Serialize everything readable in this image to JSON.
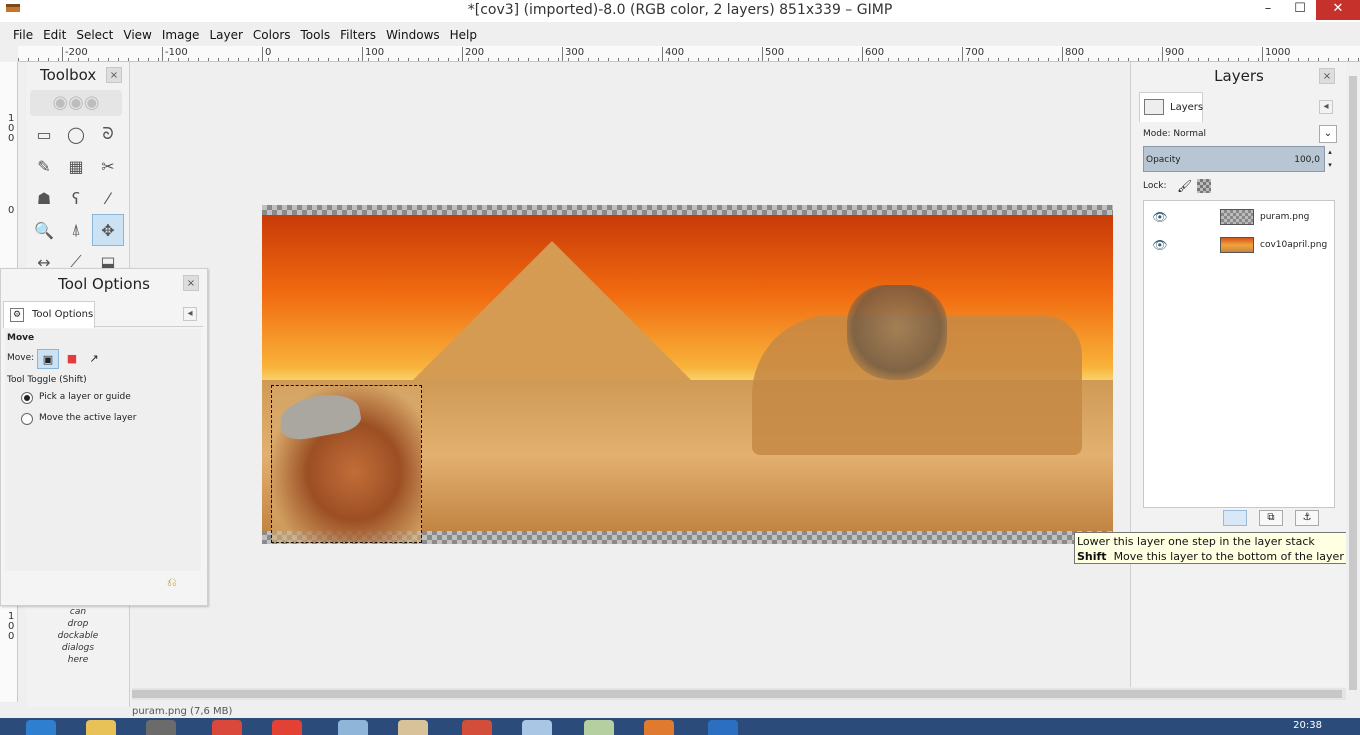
{
  "window": {
    "title": "*[cov3] (imported)-8.0 (RGB color, 2 layers) 851x339 – GIMP",
    "minimize": "–",
    "maximize": "☐",
    "close": "✕"
  },
  "menu": [
    "File",
    "Edit",
    "Select",
    "View",
    "Image",
    "Layer",
    "Colors",
    "Tools",
    "Filters",
    "Windows",
    "Help"
  ],
  "ruler": {
    "h_ticks": [
      "-200",
      "-100",
      "0",
      "100",
      "200",
      "300",
      "400",
      "500",
      "600",
      "700",
      "800",
      "900",
      "1000"
    ],
    "v_ticks": [
      "1\n0\n0",
      "0",
      "1\n0\n0"
    ]
  },
  "toolbox": {
    "title": "Toolbox",
    "close": "×",
    "drop_hint_lines": [
      "can",
      "drop",
      "dockable",
      "dialogs",
      "here"
    ],
    "tools": [
      {
        "name": "rect-select-icon",
        "glyph": "▭"
      },
      {
        "name": "ellipse-select-icon",
        "glyph": "◯"
      },
      {
        "name": "free-select-icon",
        "glyph": "ᘐ"
      },
      {
        "name": "fuzzy-select-icon",
        "glyph": "✎"
      },
      {
        "name": "select-by-color-icon",
        "glyph": "▦"
      },
      {
        "name": "scissors-icon",
        "glyph": "✂"
      },
      {
        "name": "foreground-select-icon",
        "glyph": "☗"
      },
      {
        "name": "paths-icon",
        "glyph": "ʕ"
      },
      {
        "name": "color-picker-icon",
        "glyph": "⁄"
      },
      {
        "name": "zoom-icon",
        "glyph": "🔍"
      },
      {
        "name": "measure-icon",
        "glyph": "⍋"
      },
      {
        "name": "move-icon",
        "glyph": "✥"
      },
      {
        "name": "align-icon",
        "glyph": "↔"
      },
      {
        "name": "crop-icon",
        "glyph": "⟋"
      },
      {
        "name": "transform-icon",
        "glyph": "⬓"
      }
    ]
  },
  "tool_options": {
    "title": "Tool Options",
    "close": "×",
    "tab_label": "Tool Options",
    "section": "Move",
    "move_label": "Move:",
    "toggle_label": "Tool Toggle  (Shift)",
    "options": [
      "Pick a layer or guide",
      "Move the active layer"
    ],
    "selected_option": 0
  },
  "layers": {
    "title": "Layers",
    "close": "×",
    "tab_label": "Layers",
    "mode_label": "Mode: Normal",
    "opacity_label": "Opacity",
    "opacity_value": "100,0",
    "lock_label": "Lock:",
    "items": [
      {
        "name": "puram.png"
      },
      {
        "name": "cov10april.png"
      }
    ]
  },
  "tooltip": {
    "line1": "Lower this layer one step in the layer stack",
    "line2_key": "Shift",
    "line2_text": "  Move this layer to the bottom of the layer stack"
  },
  "status": {
    "text": "puram.png (7,6 MB)"
  },
  "taskbar": {
    "clock": "20:38"
  },
  "colors": {
    "accent_active_tool": "#cbe1f4",
    "opacity_bar": "#b8c6d3",
    "tooltip_bg": "#ffffe1",
    "close_btn": "#c7312b"
  }
}
